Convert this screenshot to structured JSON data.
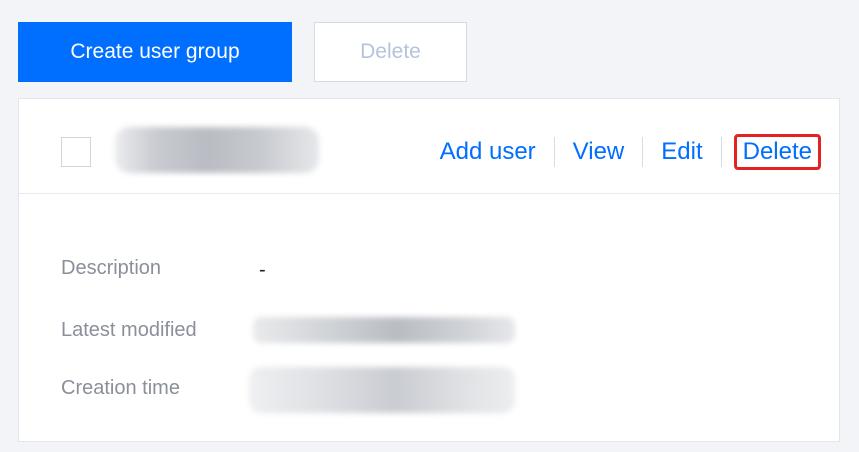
{
  "toolbar": {
    "create_label": "Create user group",
    "delete_label": "Delete"
  },
  "card": {
    "actions": {
      "add_user": "Add user",
      "view": "View",
      "edit": "Edit",
      "delete": "Delete"
    },
    "details": {
      "description_label": "Description",
      "description_value": "-",
      "modified_label": "Latest modified",
      "created_label": "Creation time"
    }
  },
  "colors": {
    "primary": "#006eff",
    "highlight": "#e52222"
  }
}
